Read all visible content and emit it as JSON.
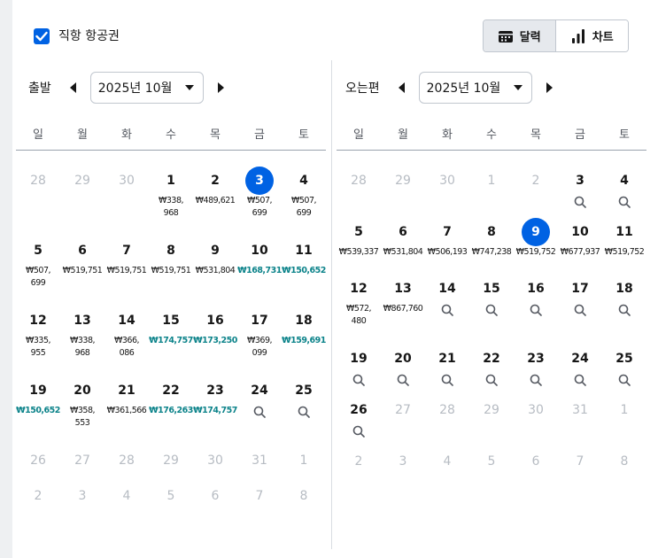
{
  "direct_flights": {
    "label": "직항 항공권",
    "checked": true
  },
  "view_toggle": {
    "calendar_label": "달력",
    "chart_label": "차트",
    "active": "calendar"
  },
  "colors": {
    "accent": "#0062e3",
    "cheap_price": "#0c838a"
  },
  "weekdays": [
    "일",
    "월",
    "화",
    "수",
    "목",
    "금",
    "토"
  ],
  "departure": {
    "label": "출발",
    "month": "2025년 10월",
    "weeks": [
      [
        {
          "d": "28",
          "m": true
        },
        {
          "d": "29",
          "m": true
        },
        {
          "d": "30",
          "m": true
        },
        {
          "d": "1",
          "p": "₩338, 968",
          "w": true
        },
        {
          "d": "2",
          "p": "₩489,621"
        },
        {
          "d": "3",
          "p": "₩507, 699",
          "w": true,
          "s": true
        },
        {
          "d": "4",
          "p": "₩507, 699",
          "w": true
        }
      ],
      [
        {
          "d": "5",
          "p": "₩507, 699",
          "w": true
        },
        {
          "d": "6",
          "p": "₩519,751"
        },
        {
          "d": "7",
          "p": "₩519,751"
        },
        {
          "d": "8",
          "p": "₩519,751"
        },
        {
          "d": "9",
          "p": "₩531,804"
        },
        {
          "d": "10",
          "p": "₩168,731",
          "g": true
        },
        {
          "d": "11",
          "p": "₩150,652",
          "g": true
        }
      ],
      [
        {
          "d": "12",
          "p": "₩335, 955",
          "w": true
        },
        {
          "d": "13",
          "p": "₩338, 968",
          "w": true
        },
        {
          "d": "14",
          "p": "₩366, 086",
          "w": true
        },
        {
          "d": "15",
          "p": "₩174,757",
          "g": true
        },
        {
          "d": "16",
          "p": "₩173,250",
          "g": true
        },
        {
          "d": "17",
          "p": "₩369, 099",
          "w": true
        },
        {
          "d": "18",
          "p": "₩159,691",
          "g": true
        }
      ],
      [
        {
          "d": "19",
          "p": "₩150,652",
          "g": true
        },
        {
          "d": "20",
          "p": "₩358, 553",
          "w": true
        },
        {
          "d": "21",
          "p": "₩361,566"
        },
        {
          "d": "22",
          "p": "₩176,263",
          "g": true
        },
        {
          "d": "23",
          "p": "₩174,757",
          "g": true
        },
        {
          "d": "24",
          "q": true
        },
        {
          "d": "25",
          "q": true
        }
      ],
      [
        {
          "d": "26",
          "m": true
        },
        {
          "d": "27",
          "m": true
        },
        {
          "d": "28",
          "m": true
        },
        {
          "d": "29",
          "m": true
        },
        {
          "d": "30",
          "m": true
        },
        {
          "d": "31",
          "m": true
        },
        {
          "d": "1",
          "m": true
        }
      ],
      [
        {
          "d": "2",
          "m": true
        },
        {
          "d": "3",
          "m": true
        },
        {
          "d": "4",
          "m": true
        },
        {
          "d": "5",
          "m": true
        },
        {
          "d": "6",
          "m": true
        },
        {
          "d": "7",
          "m": true
        },
        {
          "d": "8",
          "m": true
        }
      ]
    ]
  },
  "return": {
    "label": "오는편",
    "month": "2025년 10월",
    "weeks": [
      [
        {
          "d": "28",
          "m": true
        },
        {
          "d": "29",
          "m": true
        },
        {
          "d": "30",
          "m": true
        },
        {
          "d": "1",
          "m": true
        },
        {
          "d": "2",
          "m": true
        },
        {
          "d": "3",
          "q": true
        },
        {
          "d": "4",
          "q": true
        }
      ],
      [
        {
          "d": "5",
          "p": "₩539,337"
        },
        {
          "d": "6",
          "p": "₩531,804"
        },
        {
          "d": "7",
          "p": "₩506,193"
        },
        {
          "d": "8",
          "p": "₩747,238"
        },
        {
          "d": "9",
          "p": "₩519,752",
          "s": true
        },
        {
          "d": "10",
          "p": "₩677,937"
        },
        {
          "d": "11",
          "p": "₩519,752"
        }
      ],
      [
        {
          "d": "12",
          "p": "₩572, 480",
          "w": true
        },
        {
          "d": "13",
          "p": "₩867,760"
        },
        {
          "d": "14",
          "q": true
        },
        {
          "d": "15",
          "q": true
        },
        {
          "d": "16",
          "q": true
        },
        {
          "d": "17",
          "q": true
        },
        {
          "d": "18",
          "q": true
        }
      ],
      [
        {
          "d": "19",
          "q": true
        },
        {
          "d": "20",
          "q": true
        },
        {
          "d": "21",
          "q": true
        },
        {
          "d": "22",
          "q": true
        },
        {
          "d": "23",
          "q": true
        },
        {
          "d": "24",
          "q": true
        },
        {
          "d": "25",
          "q": true
        }
      ],
      [
        {
          "d": "26",
          "q": true
        },
        {
          "d": "27",
          "m": true
        },
        {
          "d": "28",
          "m": true
        },
        {
          "d": "29",
          "m": true
        },
        {
          "d": "30",
          "m": true
        },
        {
          "d": "31",
          "m": true
        },
        {
          "d": "1",
          "m": true
        }
      ],
      [
        {
          "d": "2",
          "m": true
        },
        {
          "d": "3",
          "m": true
        },
        {
          "d": "4",
          "m": true
        },
        {
          "d": "5",
          "m": true
        },
        {
          "d": "6",
          "m": true
        },
        {
          "d": "7",
          "m": true
        },
        {
          "d": "8",
          "m": true
        }
      ]
    ]
  }
}
